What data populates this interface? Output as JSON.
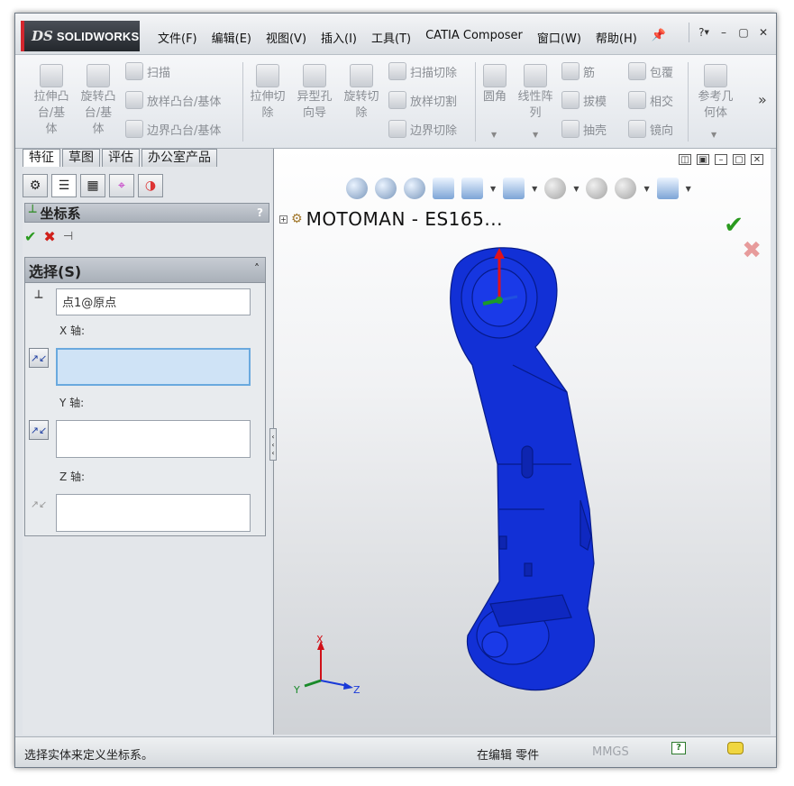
{
  "app": {
    "brand": "SOLIDWORKS",
    "logo_mark": "DS",
    "menus": [
      "文件(F)",
      "编辑(E)",
      "视图(V)",
      "插入(I)",
      "工具(T)",
      "CATIA Composer",
      "窗口(W)",
      "帮助(H)"
    ],
    "help_glyph": "?"
  },
  "toolbar": {
    "extrude_boss": "拉伸凸\n台/基\n体",
    "revolve_boss": "旋转凸\n台/基\n体",
    "sweep": "扫描",
    "loft_boss": "放样凸台/基体",
    "boundary_boss": "边界凸台/基体",
    "extrude_cut": "拉伸切\n除",
    "hole_wizard": "异型孔\n向导",
    "revolve_cut": "旋转切\n除",
    "swept_cut": "扫描切除",
    "lofted_cut": "放样切割",
    "boundary_cut": "边界切除",
    "fillet": "圆角",
    "linear_pattern": "线性阵\n列",
    "rib": "筋",
    "draft": "拔模",
    "shell": "抽壳",
    "wrap": "包覆",
    "intersect": "相交",
    "mirror": "镜向",
    "reference_geometry": "参考几\n何体",
    "more": "»"
  },
  "left_panel": {
    "tabs": [
      "特征",
      "草图",
      "评估",
      "办公室产品"
    ],
    "active_tab": 0,
    "pm_title": "坐标系",
    "pm_help": "?",
    "group": {
      "title": "选择(S)",
      "collapse": "≈",
      "origin_value": "点1@原点",
      "x_label": "X 轴:",
      "x_value": "",
      "y_label": "Y 轴:",
      "y_value": "",
      "z_label": "Z 轴:",
      "z_value": ""
    }
  },
  "viewport": {
    "tree_label": "MOTOMAN - ES165...",
    "model_color": "#1230d6",
    "triad": {
      "x": "X",
      "y": "Y",
      "z": "Z"
    }
  },
  "status": {
    "message": "选择实体来定义坐标系。",
    "mode": "在编辑 零件",
    "units": "MMGS",
    "help_icon": "?"
  }
}
